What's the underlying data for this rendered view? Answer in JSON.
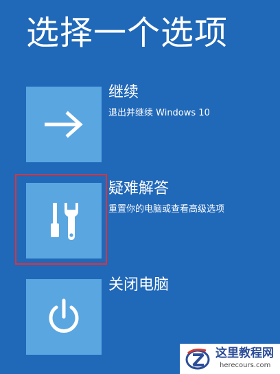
{
  "screen": {
    "title": "选择一个选项"
  },
  "options": [
    {
      "label": "继续",
      "description": "退出并继续 Windows 10",
      "icon": "arrow-right-icon"
    },
    {
      "label": "疑难解答",
      "description": "重置你的电脑或查看高级选项",
      "icon": "tools-icon"
    },
    {
      "label": "关闭电脑",
      "description": "",
      "icon": "power-icon"
    }
  ],
  "watermark": {
    "title": "这里教程网",
    "url": "herecours.com"
  },
  "colors": {
    "background": "#2068b8",
    "tile": "#5aa6e1",
    "highlight": "#e0313a",
    "watermark_text": "#2c4d98"
  }
}
